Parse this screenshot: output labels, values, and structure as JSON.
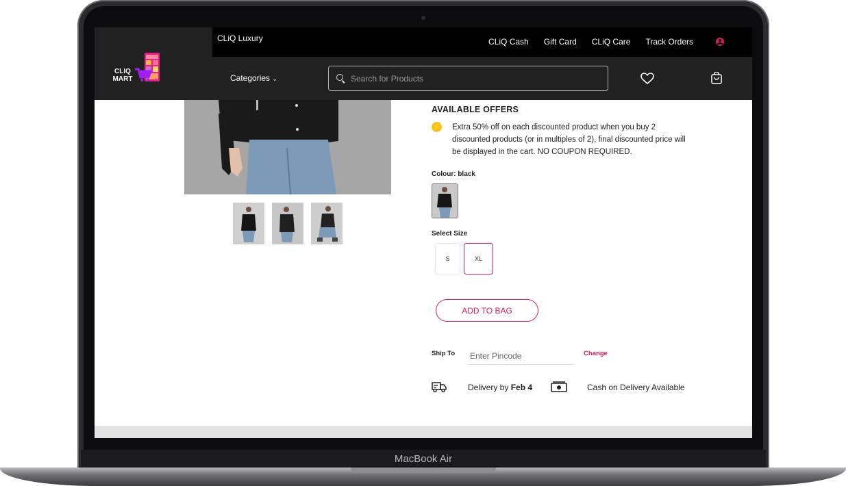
{
  "device": {
    "label": "MacBook Air"
  },
  "header": {
    "luxury_link": "CLiQ Luxury",
    "top_links": [
      "CLiQ Cash",
      "Gift Card",
      "CLiQ Care",
      "Track Orders"
    ],
    "logo_text_line1": "CLIQ",
    "logo_text_line2": "MART",
    "categories_label": "Categories",
    "search_placeholder": "Search for Products",
    "accent_color": "#da1c5c"
  },
  "offers": {
    "title": "AVAILABLE OFFERS",
    "items": [
      "Extra 50% off on each discounted product when you buy 2 discounted products (or in multiples of 2), final discounted price will be displayed in the cart. NO COUPON REQUIRED."
    ]
  },
  "colour": {
    "label": "Colour: black"
  },
  "size": {
    "label": "Select Size",
    "options": [
      "S",
      "XL"
    ],
    "selected": "XL"
  },
  "add_to_bag_label": "ADD TO BAG",
  "shipping": {
    "label": "Ship To",
    "pincode_placeholder": "Enter Pincode",
    "change_label": "Change",
    "delivery_prefix": "Delivery by",
    "delivery_date": "Feb 4",
    "cod_label": "Cash on Delivery Available"
  }
}
